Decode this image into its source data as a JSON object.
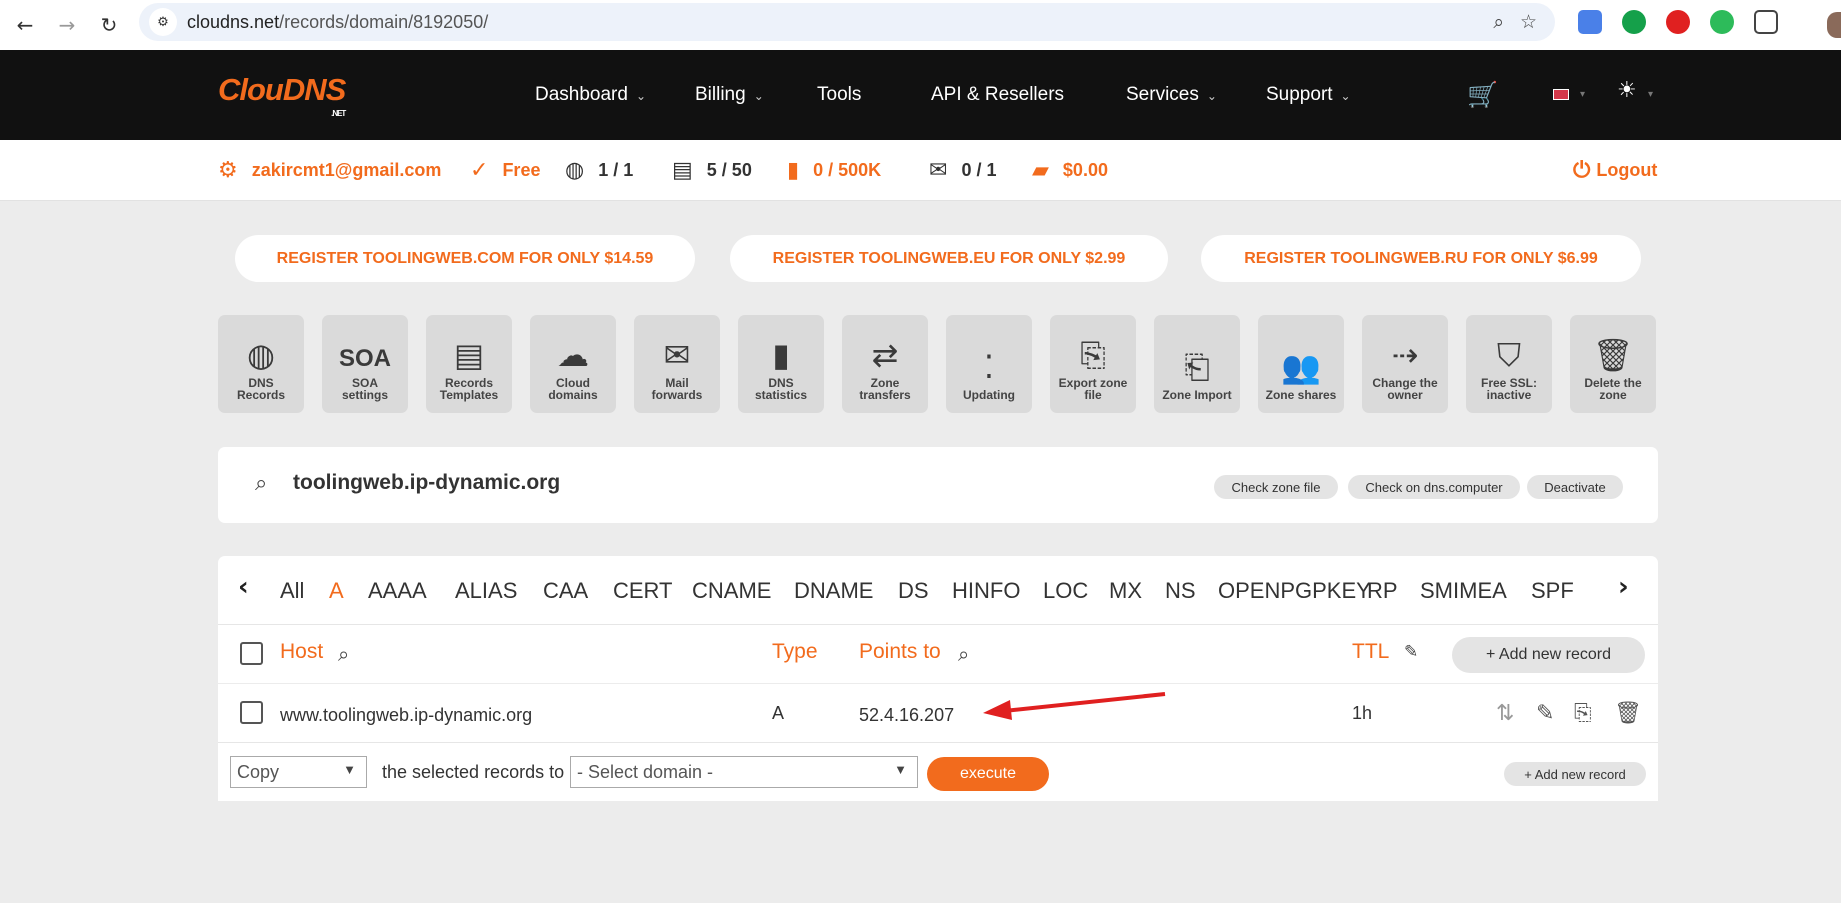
{
  "browser": {
    "url_host": "cloudns.net",
    "url_path": "/records/domain/8192050/"
  },
  "header": {
    "logo_main": "ClouDNS",
    "logo_sub": ".NET",
    "menu": [
      {
        "label": "Dashboard",
        "has_dropdown": true
      },
      {
        "label": "Billing",
        "has_dropdown": true
      },
      {
        "label": "Tools",
        "has_dropdown": false
      },
      {
        "label": "API & Resellers",
        "has_dropdown": false
      },
      {
        "label": "Services",
        "has_dropdown": true
      },
      {
        "label": "Support",
        "has_dropdown": true
      }
    ]
  },
  "userbar": {
    "email": "zakircmt1@gmail.com",
    "plan": "Free",
    "zones": "1 / 1",
    "records": "5 / 50",
    "queries": "0 / 500K",
    "mail": "0 / 1",
    "balance": "$0.00",
    "logout": "Logout"
  },
  "promos": [
    "REGISTER TOOLINGWEB.COM FOR ONLY $14.59",
    "REGISTER TOOLINGWEB.EU FOR ONLY $2.99",
    "REGISTER TOOLINGWEB.RU FOR ONLY $6.99"
  ],
  "tiles": [
    {
      "l1": "DNS",
      "l2": "Records",
      "icon": "globe-icon"
    },
    {
      "l1": "SOA",
      "l2": "settings",
      "icon": "soa-icon"
    },
    {
      "l1": "Records",
      "l2": "Templates",
      "icon": "template-icon"
    },
    {
      "l1": "Cloud",
      "l2": "domains",
      "icon": "cloud-icon"
    },
    {
      "l1": "Mail",
      "l2": "forwards",
      "icon": "mail-forward-icon"
    },
    {
      "l1": "DNS",
      "l2": "statistics",
      "icon": "bar-chart-icon"
    },
    {
      "l1": "Zone",
      "l2": "transfers",
      "icon": "transfer-icon"
    },
    {
      "l1": "Updating",
      "l2": "",
      "icon": "updating-icon"
    },
    {
      "l1": "Export zone",
      "l2": "file",
      "icon": "export-icon"
    },
    {
      "l1": "Zone Import",
      "l2": "",
      "icon": "import-icon"
    },
    {
      "l1": "Zone shares",
      "l2": "",
      "icon": "users-icon"
    },
    {
      "l1": "Change the",
      "l2": "owner",
      "icon": "change-owner-icon"
    },
    {
      "l1": "Free SSL:",
      "l2": "inactive",
      "icon": "ssl-shield-icon"
    },
    {
      "l1": "Delete the",
      "l2": "zone",
      "icon": "trash-icon"
    }
  ],
  "domain": {
    "name": "toolingweb.ip-dynamic.org",
    "buttons": [
      "Check zone file",
      "Check on dns.computer",
      "Deactivate"
    ]
  },
  "record_types": [
    "All",
    "A",
    "AAAA",
    "ALIAS",
    "CAA",
    "CERT",
    "CNAME",
    "DNAME",
    "DS",
    "HINFO",
    "LOC",
    "MX",
    "NS",
    "OPENPGPKEY",
    "RP",
    "SMIMEA",
    "SPF"
  ],
  "active_type": "A",
  "table": {
    "headers": {
      "host": "Host",
      "type": "Type",
      "points_to": "Points to",
      "ttl": "TTL"
    },
    "add_button": "+ Add new record",
    "rows": [
      {
        "host": "www.toolingweb.ip-dynamic.org",
        "type": "A",
        "points_to": "52.4.16.207",
        "ttl": "1h"
      }
    ]
  },
  "bulk": {
    "action": "Copy",
    "text": "the selected records to",
    "domain_select": "- Select domain -",
    "execute": "execute",
    "add_button": "+ Add new record"
  },
  "colors": {
    "accent": "#f26b1d",
    "nav_bg": "#111111",
    "page_bg": "#ececec",
    "annotation_arrow": "#e02020"
  }
}
